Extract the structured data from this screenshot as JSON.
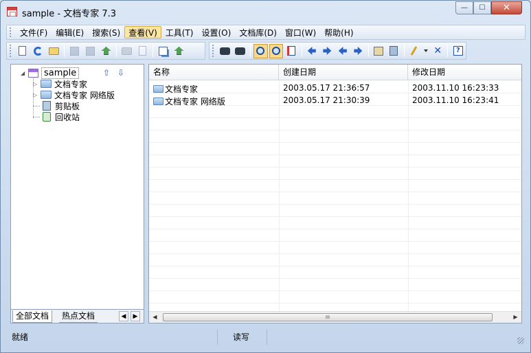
{
  "window": {
    "title": "sample - 文档专家  7.3",
    "controls": {
      "minimize": "—",
      "maximize": "☐",
      "close": "✕"
    }
  },
  "menu": [
    {
      "id": "file",
      "label": "文件(F)"
    },
    {
      "id": "edit",
      "label": "编辑(E)"
    },
    {
      "id": "search",
      "label": "搜索(S)"
    },
    {
      "id": "view",
      "label": "查看(V)",
      "active": true
    },
    {
      "id": "tools",
      "label": "工具(T)"
    },
    {
      "id": "settings",
      "label": "设置(O)"
    },
    {
      "id": "library",
      "label": "文档库(D)"
    },
    {
      "id": "window",
      "label": "窗口(W)"
    },
    {
      "id": "help",
      "label": "帮助(H)"
    }
  ],
  "toolbar_left": [
    "new-document-icon",
    "refresh-icon",
    "open-folder-icon",
    "sep",
    "save-icon",
    "save-all-icon",
    "upload-icon",
    "sep",
    "print-icon",
    "print-preview-icon",
    "sep",
    "copy-icon",
    "paste-icon"
  ],
  "toolbar_right": [
    "find-icon",
    "find-next-icon",
    "sep",
    "zoom-icon",
    "zoom-page-icon",
    "page-view-icon",
    "sep",
    "back-icon",
    "forward-icon",
    "back-all-icon",
    "forward-all-icon",
    "sep",
    "properties-icon",
    "clipboard-icon",
    "sep",
    "pen-icon",
    "dropdown-icon",
    "delete-icon",
    "sep",
    "help-icon"
  ],
  "tree": {
    "root": "sample",
    "children": [
      {
        "label": "文档专家",
        "type": "folder"
      },
      {
        "label": "文档专家 网络版",
        "type": "folder"
      },
      {
        "label": "剪贴板",
        "type": "clipboard"
      },
      {
        "label": "回收站",
        "type": "recycle"
      }
    ]
  },
  "tabs": {
    "all": "全部文档",
    "hot": "热点文档"
  },
  "list": {
    "columns": [
      "名称",
      "创建日期",
      "修改日期"
    ],
    "rows": [
      {
        "name": "文档专家",
        "created": "2003.05.17 21:36:57",
        "modified": "2003.11.10 16:23:33"
      },
      {
        "name": "文档专家 网络版",
        "created": "2003.05.17 21:30:39",
        "modified": "2003.11.10 16:23:41"
      }
    ],
    "scroll_grip": "III"
  },
  "status": {
    "ready": "就绪",
    "mode": "读写"
  }
}
